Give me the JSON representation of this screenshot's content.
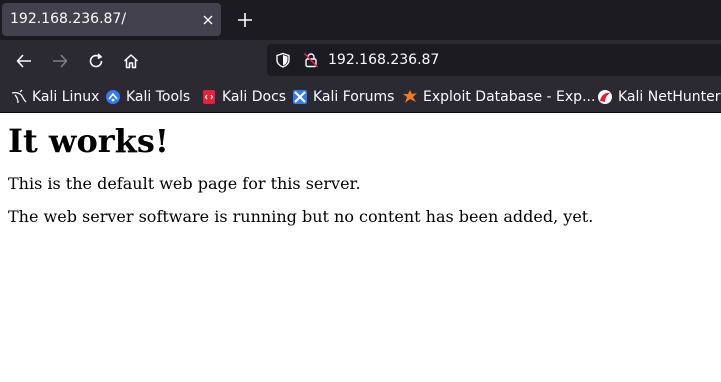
{
  "tab": {
    "title": "192.168.236.87/"
  },
  "url": {
    "address": "192.168.236.87"
  },
  "bookmarks": [
    {
      "label": "Kali Linux"
    },
    {
      "label": "Kali Tools"
    },
    {
      "label": "Kali Docs"
    },
    {
      "label": "Kali Forums"
    },
    {
      "label": "Exploit Database - Exp..."
    },
    {
      "label": "Kali NetHunter"
    }
  ],
  "page": {
    "heading": "It works!",
    "line1": "This is the default web page for this server.",
    "line2": "The web server software is running but no content has been added, yet."
  },
  "colors": {
    "tab_bg": "#42414d",
    "toolbar_bg": "#2b2a33",
    "titlebar_bg": "#1c1b22",
    "text_light": "#fbfbfe"
  }
}
